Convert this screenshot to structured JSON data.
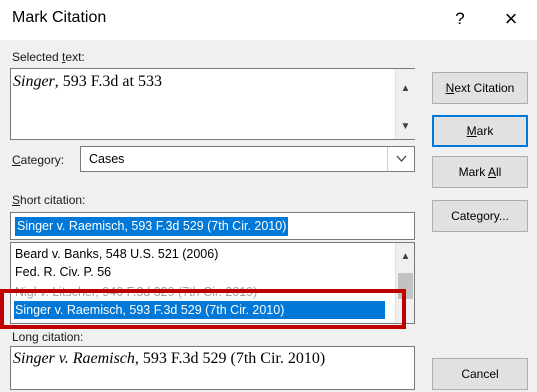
{
  "window": {
    "title": "Mark Citation",
    "help_glyph": "?",
    "close_glyph": "×"
  },
  "selected_text": {
    "label_pre": "Selected ",
    "label_key": "t",
    "label_post": "ext:",
    "value_italic": "Singer",
    "value_rest": ", 593 F.3d at 533"
  },
  "category": {
    "label_key": "C",
    "label_post": "ategory:",
    "value": "Cases"
  },
  "short_citation": {
    "label_key": "S",
    "label_post": "hort citation:",
    "input_value": "Singer v. Raemisch, 593 F.3d 529 (7th Cir. 2010)",
    "list": [
      "Beard v. Banks, 548 U.S. 521 (2006)",
      "Fed. R. Civ. P. 56",
      "Nigl v. Litscher, 940 F.3d 329 (7th Cir. 2019)",
      "Singer v. Raemisch, 593 F.3d 529 (7th Cir. 2010)"
    ],
    "selected_index": 3
  },
  "long_citation": {
    "label": "Long citation:",
    "value_italic": "Singer v. Raemisch",
    "value_rest": ", 593 F.3d 529 (7th Cir. 2010)"
  },
  "buttons": {
    "next_key": "N",
    "next_rest": "ext Citation",
    "mark_key": "M",
    "mark_rest": "ark",
    "markall_pre": "Mark ",
    "markall_key": "A",
    "markall_post": "ll",
    "category_pre": "Cate",
    "category_key": "g",
    "category_post": "ory...",
    "cancel": "Cancel"
  },
  "icons": {
    "scroll_up": "▲",
    "scroll_down": "▼",
    "dropdown": "chevron-down-icon"
  },
  "colors": {
    "selection": "#0078d7",
    "highlight_box": "#c00000",
    "default_button_border": "#0078d7"
  }
}
